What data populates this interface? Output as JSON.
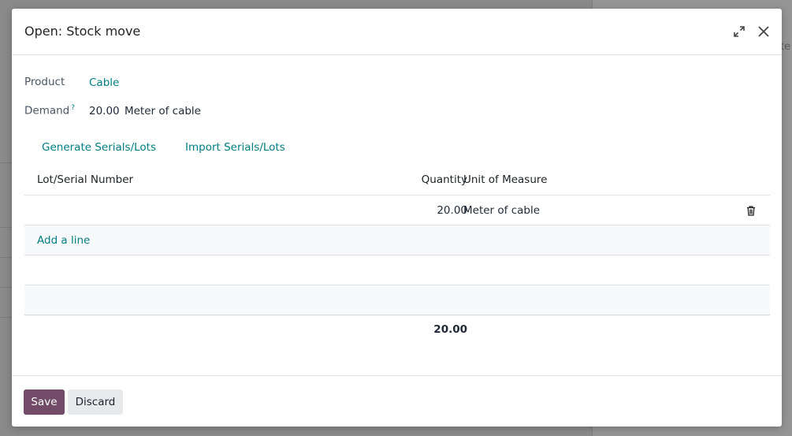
{
  "background": {
    "hint_text": "te"
  },
  "dialog": {
    "title": "Open: Stock move",
    "icons": {
      "expand": "expand-icon",
      "close": "close-icon"
    }
  },
  "form": {
    "product_label": "Product",
    "product_value": "Cable",
    "demand_label": "Demand",
    "demand_help": "?",
    "demand_qty": "20.00",
    "demand_uom": "Meter of cable"
  },
  "actions": {
    "generate": "Generate Serials/Lots",
    "import": "Import Serials/Lots"
  },
  "table": {
    "columns": [
      "Lot/Serial Number",
      "Quantity",
      "Unit of Measure"
    ],
    "rows": [
      {
        "lot": "",
        "quantity": "20.00",
        "uom": "Meter of cable"
      }
    ],
    "add_line": "Add a line",
    "total": "20.00"
  },
  "footer": {
    "save": "Save",
    "discard": "Discard"
  },
  "colors": {
    "accent": "#017e84",
    "primary": "#714b67"
  }
}
